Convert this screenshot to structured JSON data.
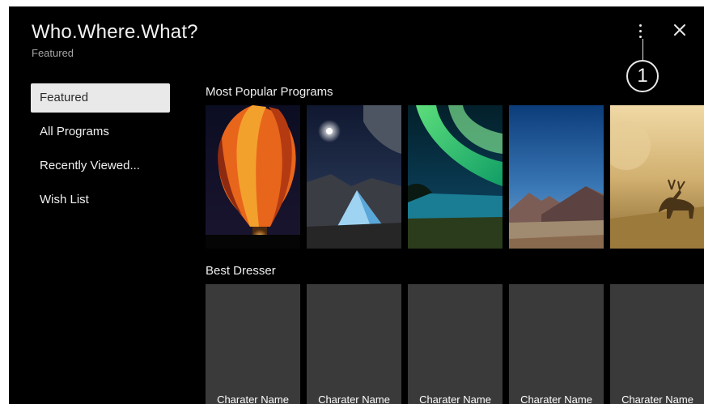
{
  "app": {
    "title": "Who.Where.What?",
    "subtitle": "Featured"
  },
  "header": {
    "more_icon": "more-vertical-icon",
    "close_icon": "close-icon",
    "callout_label": "1"
  },
  "nav": {
    "items": [
      {
        "label": "Featured"
      },
      {
        "label": "All Programs"
      },
      {
        "label": "Recently Viewed..."
      },
      {
        "label": "Wish List"
      }
    ]
  },
  "sections": {
    "popular": {
      "title": "Most Popular Programs",
      "posters": [
        "hot-air-balloon",
        "tent-under-moon",
        "aurora-lake",
        "mountain-valley",
        "deer-in-fog"
      ]
    },
    "dresser": {
      "title": "Best Dresser",
      "cards": [
        {
          "name": "Charater Name"
        },
        {
          "name": "Charater Name"
        },
        {
          "name": "Charater Name"
        },
        {
          "name": "Charater Name"
        },
        {
          "name": "Charater Name"
        }
      ]
    }
  },
  "colors": {
    "screen_bg": "#000000",
    "selected_bg": "#e9e9e9",
    "card_bg": "#3a3a3a"
  }
}
